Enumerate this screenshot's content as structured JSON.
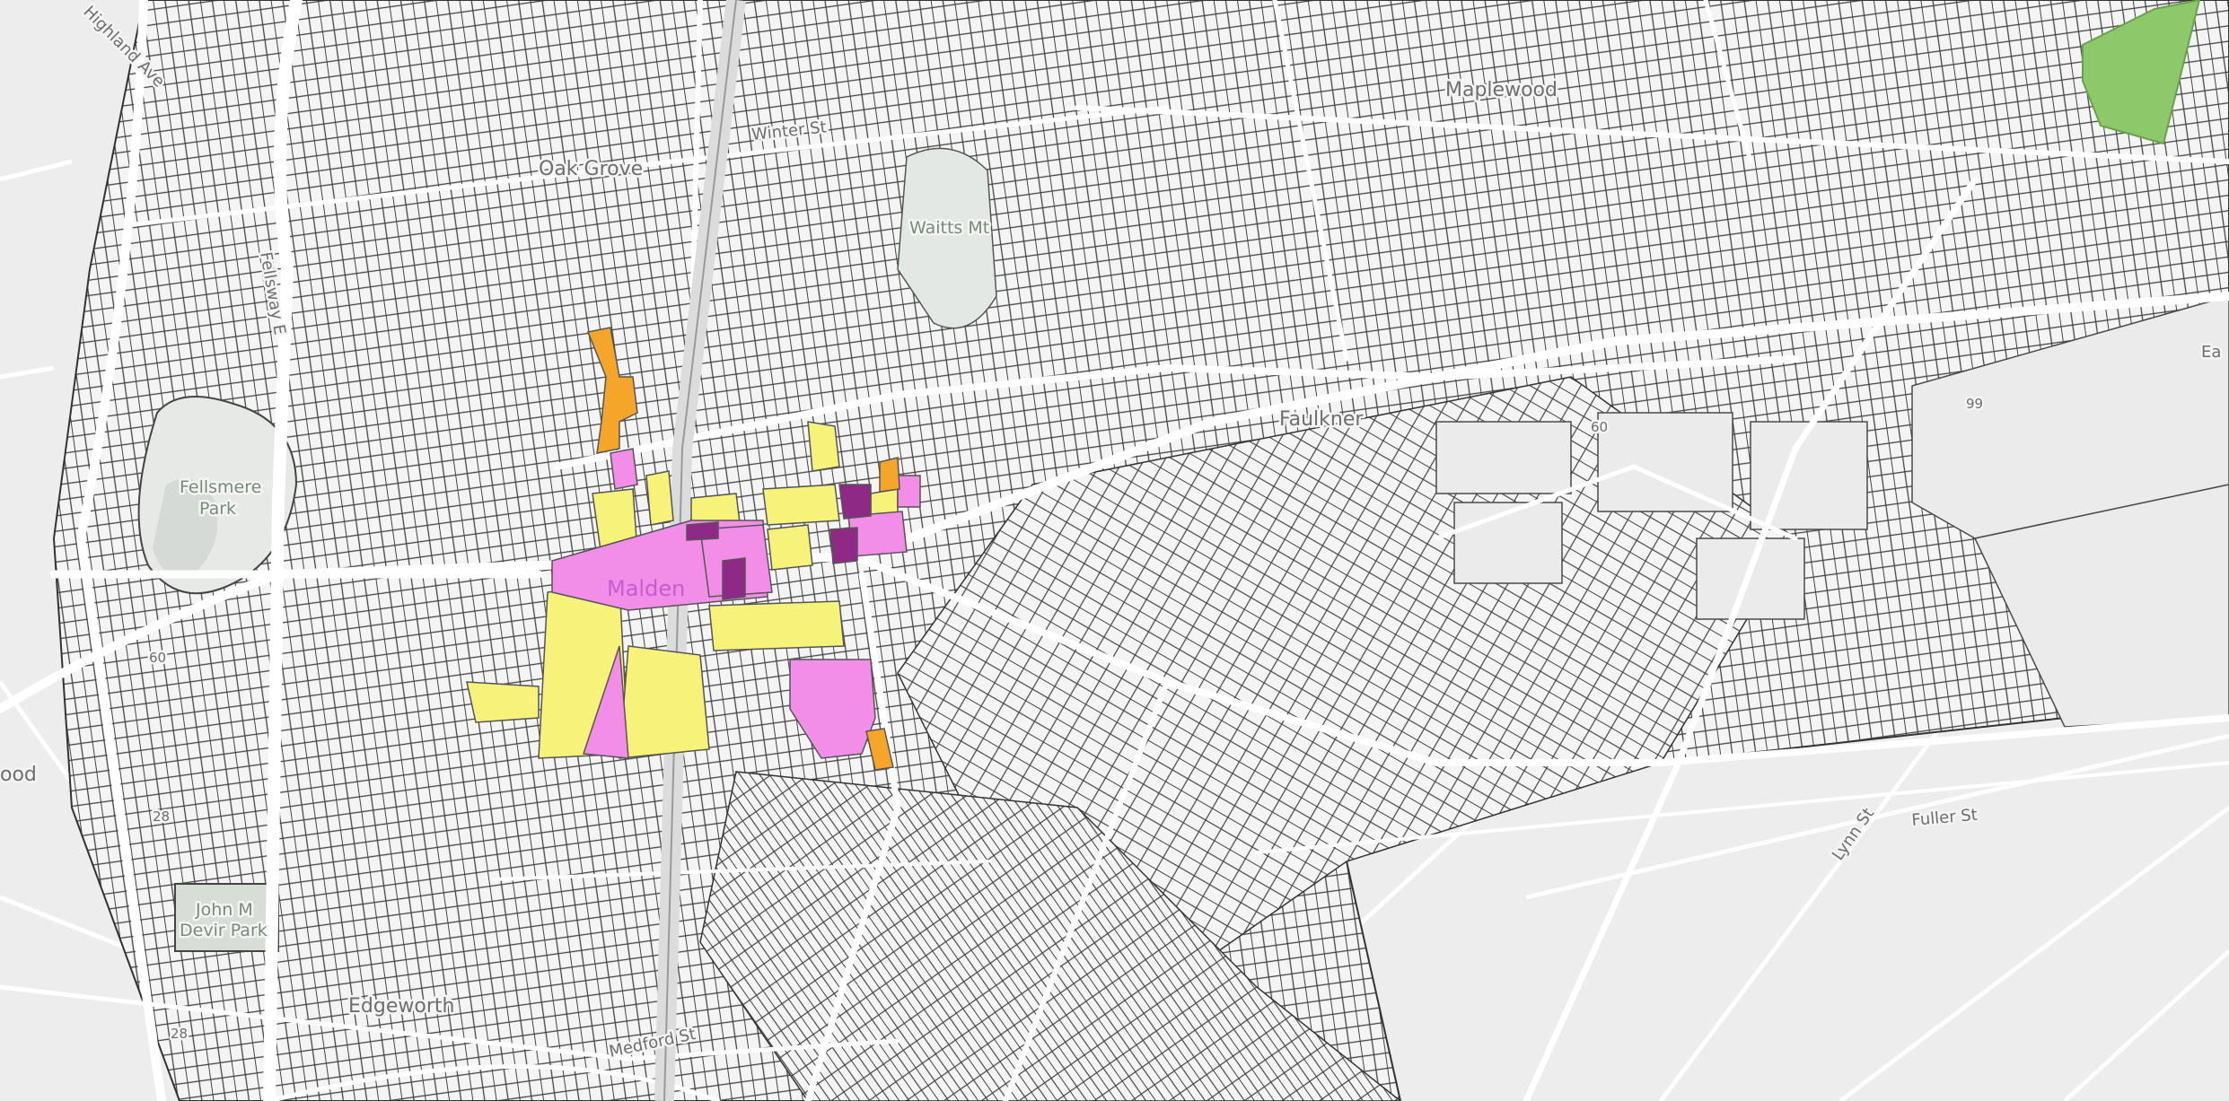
{
  "map": {
    "place_labels": {
      "oak_grove": "Oak Grove",
      "maplewood": "Maplewood",
      "faulkner": "Faulkner",
      "malden": "Malden",
      "edgeworth": "Edgeworth",
      "wood": "ood"
    },
    "park_labels": {
      "fellsmere_1": "Fellsmere",
      "fellsmere_2": "Park",
      "devir_1": "John M",
      "devir_2": "Devir Park",
      "waitts": "Waitts Mt"
    },
    "street_labels": {
      "highland": "Highland Ave",
      "fellsway": "Fellsway E",
      "winter": "Winter St",
      "medford": "Medford St",
      "fuller": "Fuller St",
      "lynn": "Lynn St",
      "east_edge": "Ea"
    },
    "route_shields": {
      "r60_west": "60",
      "r60_east": "60",
      "r99": "99",
      "r28_north": "28",
      "r28_south": "28"
    },
    "colors": {
      "background": "#ededed",
      "parcel_fill": "#f3f3f3",
      "parcel_outline": "#3d3d3d",
      "road": "#ffffff",
      "park": "#cfd8cf",
      "green_area": "#8dc86a",
      "zone_yellow": "#f7f37a",
      "zone_pink": "#f28ee8",
      "zone_orange": "#f4a52a",
      "zone_purple": "#8e2a86"
    }
  }
}
